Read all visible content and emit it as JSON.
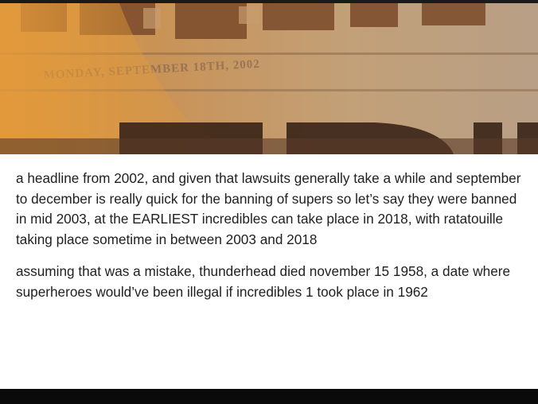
{
  "image": {
    "description_alt": "",
    "dateline": "MONDAY, SEPTEMBER 18TH, 2002"
  },
  "post": {
    "paragraphs": [
      "a headline from 2002, and given that lawsuits generally take a while and september to december is really quick for the banning of supers so let’s say they were banned in mid 2003, at the EARLIEST incredibles can take place in 2018, with ratatouille taking place sometime in between 2003 and 2018",
      "assuming that was a mistake, thunderhead died november 15 1958, a date where superheroes would’ve been illegal if incredibles 1 took place in 1962"
    ]
  },
  "colors": {
    "text": "#1f1f1f",
    "image_tint": "#c98a3f",
    "bottom_bar": "#0a0a0a"
  }
}
